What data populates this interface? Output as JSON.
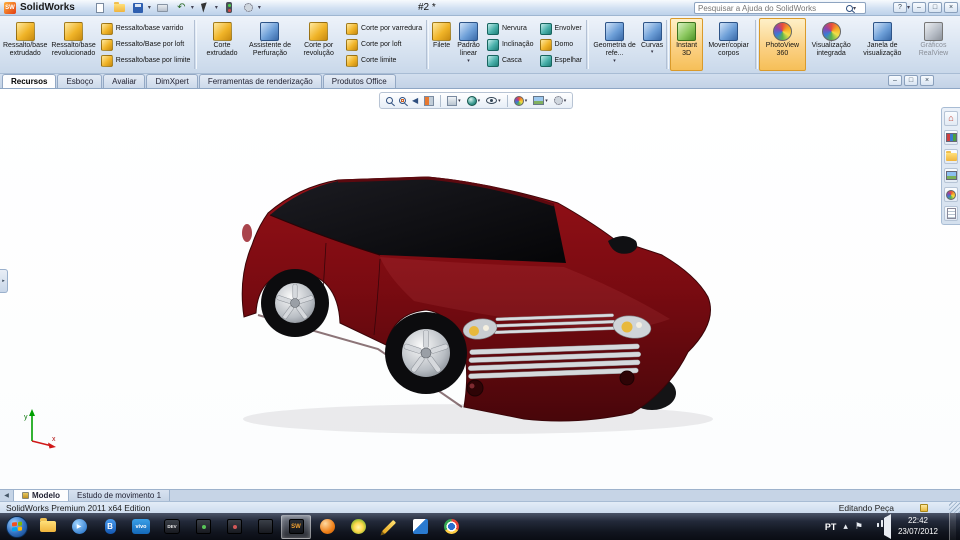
{
  "titlebar": {
    "app_name": "SolidWorks",
    "doc_title": "#2 *",
    "search_placeholder": "Pesquisar a Ajuda do SolidWorks"
  },
  "icons": {
    "caret": "▾",
    "help": "?",
    "minimize": "–",
    "restore": "□",
    "close": "×",
    "prev_arrow": "◀",
    "flyout": "▸",
    "home": "⌂",
    "hidden_tray": "▴",
    "flag": "⚑",
    "play": "▶",
    "undo": "↶",
    "sw_logo": "SW",
    "bluetooth_b": "B"
  },
  "ribbon": {
    "groups": [
      {
        "large": [
          "Ressalto/base extrudado",
          "Ressalto/base revolucionado"
        ],
        "small": [
          "Ressalto/base varrido",
          "Ressalto/Base por loft",
          "Ressalto/base por limite"
        ]
      },
      {
        "large": [
          "Corte extrudado",
          "Assistente de Perfuração",
          "Corte por revolução"
        ],
        "small": [
          "Corte por varredura",
          "Corte por loft",
          "Corte limite"
        ]
      },
      {
        "large": [
          "Filete",
          "Padrão linear"
        ],
        "small": [
          "Nervura",
          "Inclinação",
          "Casca"
        ],
        "small2": [
          "Envolver",
          "Domo",
          "Espelhar"
        ]
      },
      {
        "large": [
          "Geometria de refe...",
          "Curvas"
        ]
      },
      {
        "large": [
          "Instant 3D",
          "Mover/copiar corpos"
        ]
      },
      {
        "large": [
          "PhotoView 360",
          "Visualização integrada",
          "Janela de visualização",
          "Gráficos RealView"
        ]
      }
    ]
  },
  "command_tabs": [
    "Recursos",
    "Esboço",
    "Avaliar",
    "DimXpert",
    "Ferramentas de renderização",
    "Produtos Office"
  ],
  "viewport": {
    "triad": {
      "x_label": "x",
      "y_label": "y"
    }
  },
  "doc_tabs": [
    "Modelo",
    "Estudo de movimento 1"
  ],
  "statusbar": {
    "left": "SolidWorks Premium 2011 x64 Edition",
    "right": "Editando Peça"
  },
  "taskbar": {
    "language": "PT",
    "clock_time": "22:42",
    "clock_date": "23/07/2012",
    "vivo_label": "vivo",
    "dev_label": "DEV",
    "sw_label": "SW"
  },
  "colors": {
    "car_body": "#7a0c11",
    "ribbon_highlight": "#fbd184",
    "taskbar_bg": "#11151f"
  }
}
